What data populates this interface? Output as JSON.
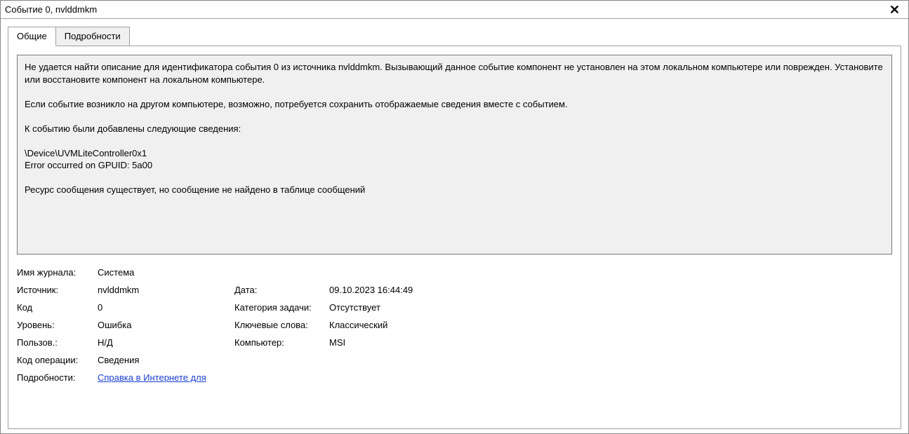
{
  "title": "Событие 0, nvlddmkm",
  "tabs": {
    "general": "Общие",
    "details": "Подробности"
  },
  "desc": "Не удается найти описание для идентификатора события 0 из источника nvlddmkm. Вызывающий данное событие компонент не установлен на этом локальном компьютере или поврежден. Установите или восстановите компонент на локальном компьютере.\n\nЕсли событие возникло на другом компьютере, возможно, потребуется сохранить отображаемые сведения вместе с событием.\n\nК событию были добавлены следующие сведения:\n\n\\Device\\UVMLiteController0x1\nError occurred on GPUID: 5a00\n\nРесурс сообщения существует, но сообщение не найдено в таблице сообщений",
  "labels": {
    "log_name": "Имя журнала:",
    "source": "Источник:",
    "date": "Дата:",
    "code": "Код",
    "task_category": "Категория задачи:",
    "level": "Уровень:",
    "keywords": "Ключевые слова:",
    "user": "Пользов.:",
    "computer": "Компьютер:",
    "opcode": "Код операции:",
    "more_info": "Подробности:"
  },
  "values": {
    "log_name": "Система",
    "source": "nvlddmkm",
    "date": "09.10.2023 16:44:49",
    "code": "0",
    "task_category": "Отсутствует",
    "level": "Ошибка",
    "keywords": "Классический",
    "user": "Н/Д",
    "computer": "MSI",
    "opcode": "Сведения",
    "more_info_link": "Справка в Интернете для "
  }
}
